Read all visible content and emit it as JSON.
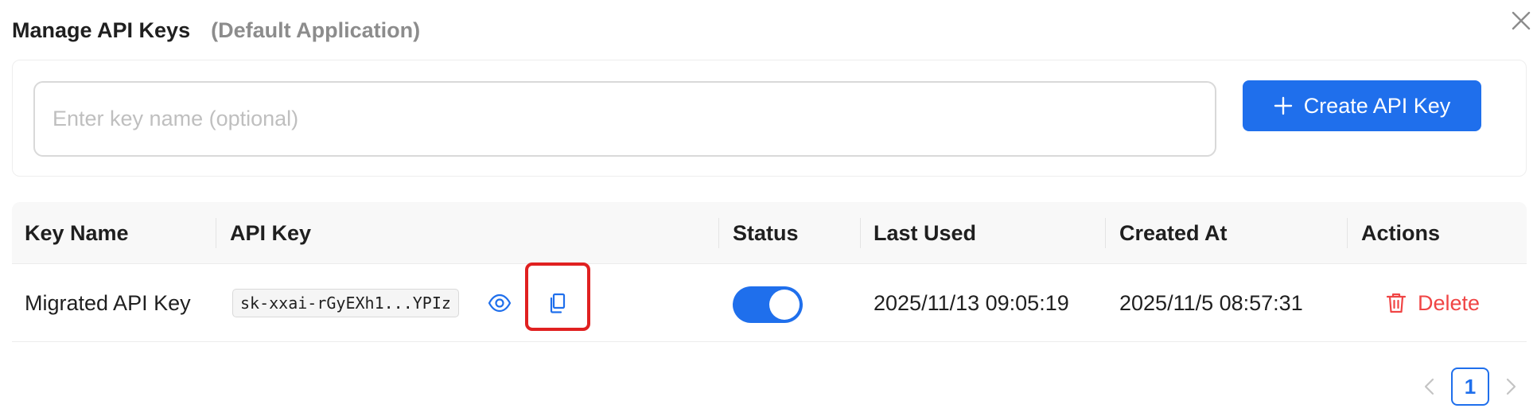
{
  "dialog": {
    "title": "Manage API Keys",
    "subtitle": "(Default Application)"
  },
  "create": {
    "input_placeholder": "Enter key name (optional)",
    "input_value": "",
    "button_label": "Create API Key"
  },
  "table": {
    "headers": [
      "Key Name",
      "API Key",
      "Status",
      "Last Used",
      "Created At",
      "Actions"
    ],
    "rows": [
      {
        "key_name": "Migrated API Key",
        "api_key": "sk-xxai-rGyEXh1...YPIz",
        "status_enabled": true,
        "last_used": "2025/11/13 09:05:19",
        "created_at": "2025/11/5 08:57:31",
        "delete_label": "Delete"
      }
    ]
  },
  "pagination": {
    "current_page": "1"
  },
  "icons": {
    "close": "close-icon",
    "plus": "plus-icon",
    "view": "eye-icon",
    "copy": "copy-icon",
    "delete": "trash-icon",
    "prev": "chevron-left-icon",
    "next": "chevron-right-icon"
  },
  "colors": {
    "primary": "#1f6fec",
    "danger": "#f04545",
    "highlight": "#e02020"
  }
}
